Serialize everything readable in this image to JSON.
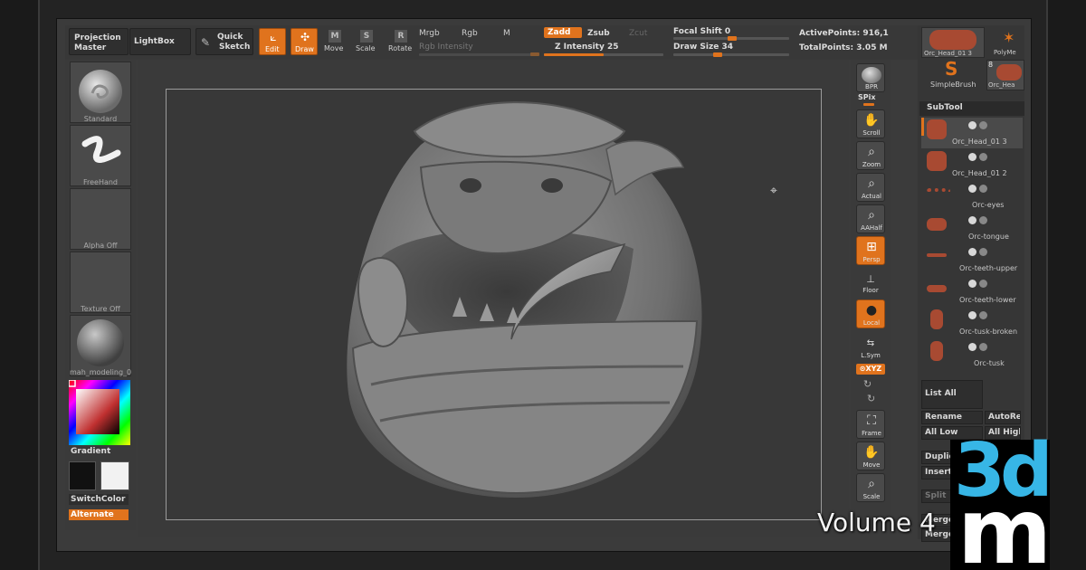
{
  "topbar": {
    "projection_master": [
      "Projection",
      "Master"
    ],
    "lightbox": "LightBox",
    "quick_sketch": [
      "Quick",
      "Sketch"
    ],
    "edit": "Edit",
    "draw": "Draw",
    "move": "Move",
    "scale": "Scale",
    "rotate": "Rotate",
    "mrgb": "Mrgb",
    "rgb": "Rgb",
    "m": "M",
    "rgb_intensity": "Rgb Intensity",
    "zadd": "Zadd",
    "zsub": "Zsub",
    "zcut": "Zcut",
    "z_intensity": "Z Intensity 25",
    "focal_shift": "Focal Shift 0",
    "draw_size": "Draw Size 34",
    "active_points": "ActivePoints: 916,1",
    "total_points": "TotalPoints: 3.05 M"
  },
  "left": {
    "brush": "Standard",
    "stroke": "FreeHand",
    "alpha": "Alpha  Off",
    "texture": "Texture  Off",
    "material": "mah_modeling_0",
    "gradient": "Gradient",
    "switchcolor": "SwitchColor",
    "alternate": "Alternate"
  },
  "shelf": {
    "bpr": "BPR",
    "spix": "SPix",
    "scroll": "Scroll",
    "zoom": "Zoom",
    "actual": "Actual",
    "aahalf": "AAHalf",
    "persp": "Persp",
    "floor": "Floor",
    "local": "Local",
    "lsym": "L.Sym",
    "xyz": "⊙XYZ",
    "frame": "Frame",
    "move": "Move",
    "scale": "Scale"
  },
  "tray": {
    "top_tool_1": "Orc_Head_01 3",
    "top_tool_2": "PolyMe",
    "simplebrush": "SimpleBrush",
    "top_tool_4": "Orc_Hea",
    "top_count": "8",
    "subtool_title": "SubTool",
    "subtools": [
      {
        "name": "Orc_Head_01 3"
      },
      {
        "name": "Orc_Head_01 2"
      },
      {
        "name": "Orc-eyes"
      },
      {
        "name": "Orc-tongue"
      },
      {
        "name": "Orc-teeth-upper"
      },
      {
        "name": "Orc-teeth-lower"
      },
      {
        "name": "Orc-tusk-broken"
      },
      {
        "name": "Orc-tusk"
      }
    ],
    "list_all": "List  All",
    "rename": "Rename",
    "autore": "AutoRe",
    "all_low": "All  Low",
    "all_high": "All  High",
    "duplic": "Duplic",
    "insert": "Insert",
    "split": "Split",
    "merge": "Merge",
    "merge2": "Merge"
  },
  "overlay": {
    "logo_3d": "3d",
    "logo_m": "m",
    "volume": "Volume 4"
  },
  "colors": {
    "accent": "#e0731d",
    "logo_blue": "#37b6e6"
  }
}
